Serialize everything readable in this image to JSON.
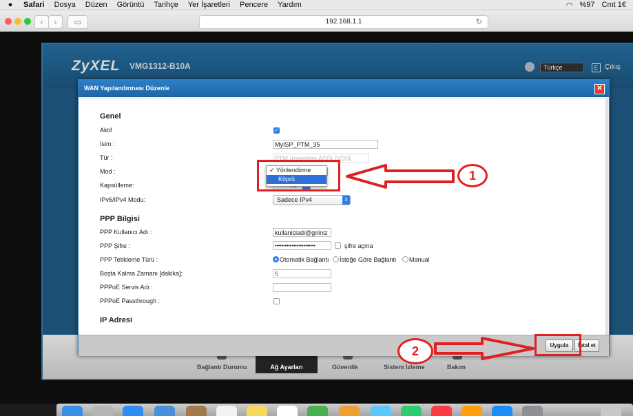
{
  "menubar": {
    "app": "Safari",
    "items": [
      "Dosya",
      "Düzen",
      "Görüntü",
      "Tarihçe",
      "Yer İşaretleri",
      "Pencere",
      "Yardım"
    ],
    "battery": "%97",
    "clock": "Cmt 1€"
  },
  "browser": {
    "url": "192.168.1.1"
  },
  "router": {
    "logo": "ZyXEL",
    "model": "VMG1312-B10A",
    "language": "Türkçe",
    "logout": "Çıkış",
    "nav": [
      "Bağlantı Durumu",
      "Ağ Ayarları",
      "Güvenlik",
      "Sistem İzleme",
      "Bakım"
    ]
  },
  "dialog": {
    "title": "WAN Yapılandırması Düzenle",
    "general": {
      "heading": "Genel",
      "active_label": "Aktif",
      "active_checked": true,
      "name_label": "İsim :",
      "name_value": "MyISP_PTM_35",
      "type_label": "Tür :",
      "type_value": "PTM üzerinden ADSL/VDSL",
      "mode_label": "Mod :",
      "encap_label": "Kapsülleme:",
      "encap_value": "PPPoE",
      "ipmode_label": "IPv6/IPv4 Modu:",
      "ipmode_value": "Sadece IPv4"
    },
    "mode_options": [
      "Yönlendirme",
      "Köprü"
    ],
    "mode_selected_mark": "✓",
    "ppp": {
      "heading": "PPP Bilgisi",
      "user_label": "PPP Kullanıcı Adı :",
      "user_value": "kullaniciadi@giriniz",
      "pass_label": "PPP Şifre :",
      "pass_value": "••••••••••••••••••••••••",
      "show_pass": "şifre açma",
      "trigger_label": "PPP Tetikleme Türü :",
      "trigger_options": [
        "Otomatik Bağlantı",
        "İsteğe Göre Bağlantı",
        "Manual"
      ],
      "idle_label": "Boşta Kalma Zamanı [dakika]:",
      "idle_value": "5",
      "service_label": "PPPoE Servis Adı :",
      "passthrough_label": "PPPoE Passthrough :"
    },
    "ip": {
      "heading": "IP Adresi"
    },
    "apply": "Uygula",
    "cancel": "İptal et"
  },
  "annotations": {
    "step1": "1",
    "step2": "2",
    "color": "#e02020"
  }
}
